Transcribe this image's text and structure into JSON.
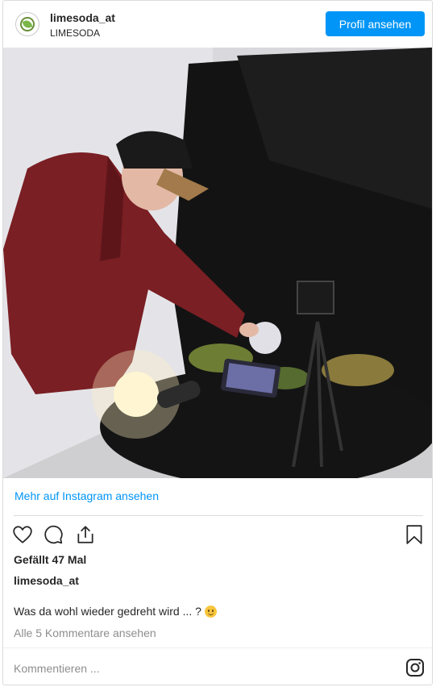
{
  "header": {
    "username": "limesoda_at",
    "display_name": "LIMESODA",
    "profile_button": "Profil ansehen",
    "avatar_icon": "limesoda-leaf-logo"
  },
  "photo": {
    "description_icon": "photo"
  },
  "more_link": "Mehr auf Instagram ansehen",
  "actions": {
    "like_icon": "heart-icon",
    "comment_icon": "comment-icon",
    "share_icon": "share-icon",
    "save_icon": "bookmark-icon"
  },
  "likes": "Gefällt 47 Mal",
  "owner": "limesoda_at",
  "caption": "Was da wohl wieder gedreht wird ... ?",
  "comments_link": "Alle 5 Kommentare ansehen",
  "comment_placeholder": "Kommentieren ...",
  "colors": {
    "accent": "#0095f6",
    "text": "#262626",
    "muted": "#8e8e8e",
    "border": "#dbdbdb"
  }
}
